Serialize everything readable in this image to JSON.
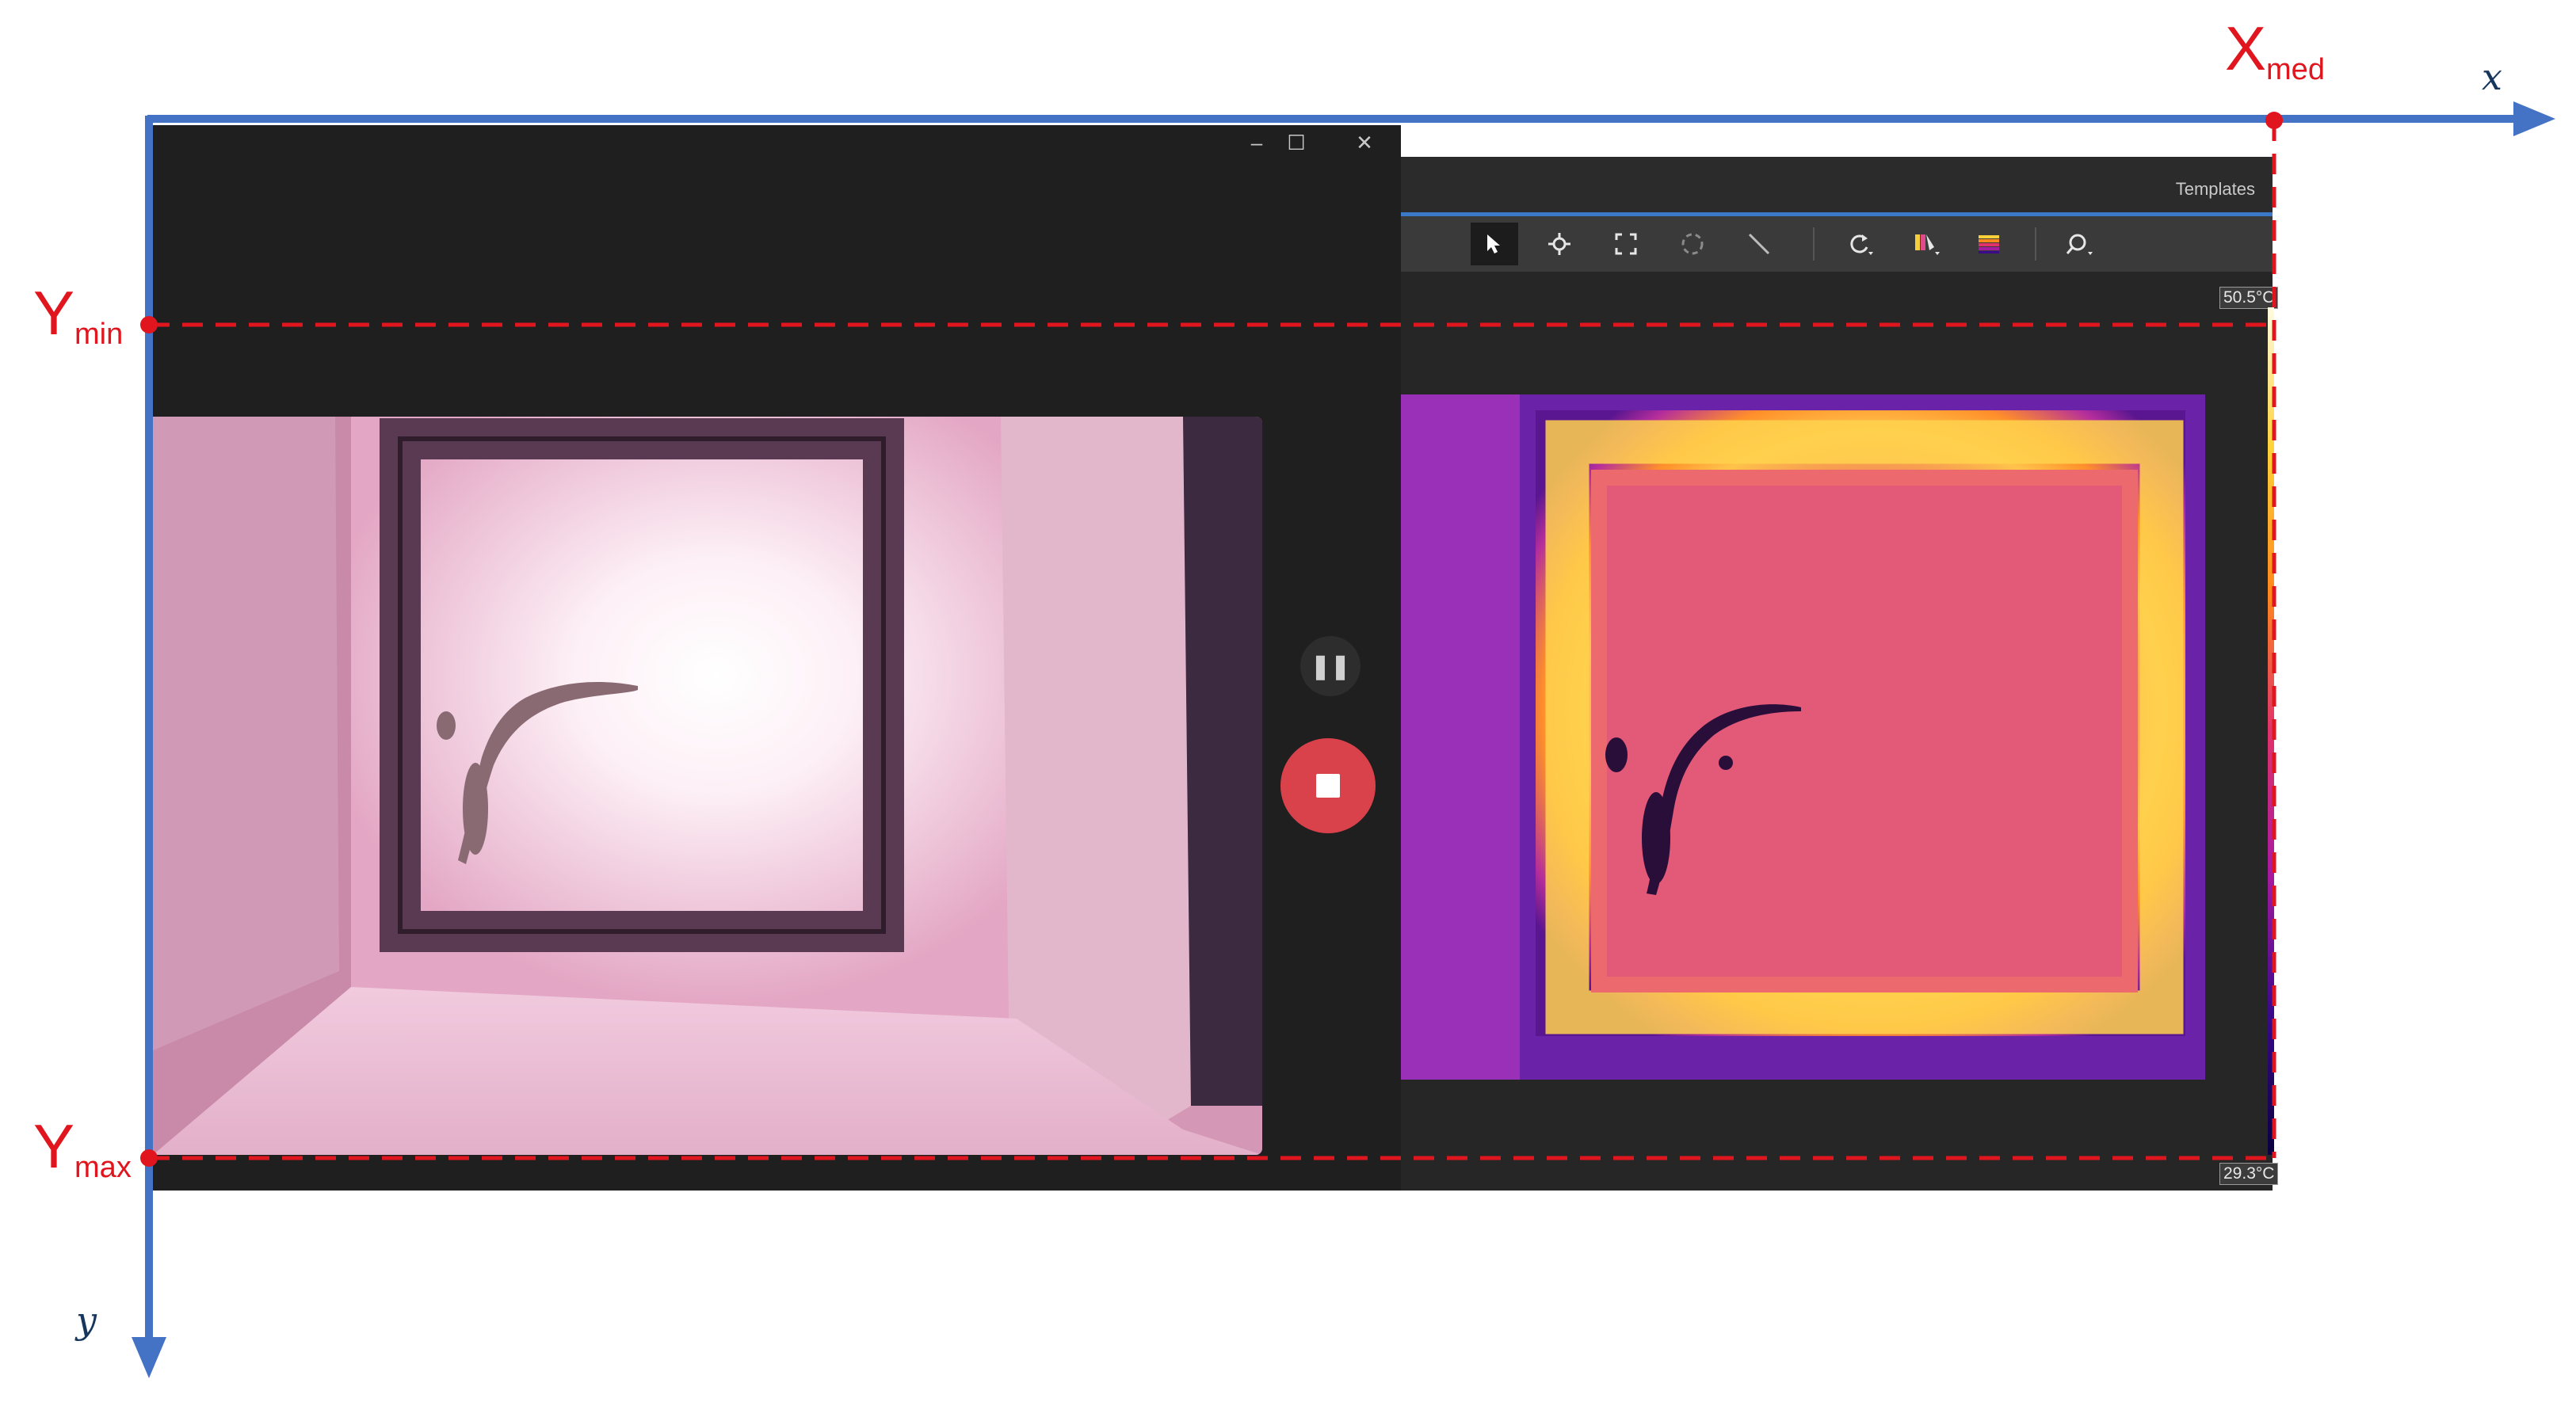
{
  "annotation": {
    "x_axis_label": "x",
    "y_axis_label": "y",
    "x_med": {
      "main": "X",
      "sub": "med"
    },
    "y_min": {
      "main": "Y",
      "sub": "min"
    },
    "y_max": {
      "main": "Y",
      "sub": "max"
    },
    "axis_color": "#4472c4",
    "guide_color": "#e0151d"
  },
  "camera_window": {
    "titlebar_buttons": [
      "–",
      "☐",
      "✕"
    ],
    "pause_icon": "pause-icon",
    "stop_icon": "stop-icon"
  },
  "thermal_window": {
    "templates_label": "Templates",
    "tools": [
      "select-arrow-icon",
      "crosshair-spot-icon",
      "box-area-icon",
      "ellipse-area-icon",
      "line-icon",
      "rotate-icon",
      "palette-icon",
      "colormap-icon",
      "zoom-icon"
    ],
    "temp_max": "50.5°C",
    "temp_min": "29.3°C",
    "palette_colors": [
      "#fffbe0",
      "#ffd23a",
      "#ff8a1c",
      "#e0336a",
      "#a81aa0",
      "#3a0a8a",
      "#0a0040"
    ]
  }
}
